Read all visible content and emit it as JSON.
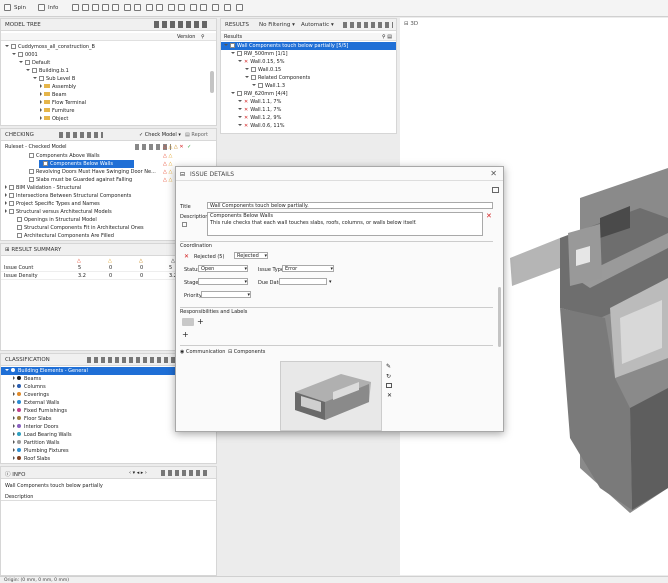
{
  "toolbar": {
    "spin": "Spin",
    "info": "Info"
  },
  "model_tree": {
    "title": "MODEL TREE",
    "version_col": "Version",
    "items": [
      {
        "label": "Cuddymoss_all_construction_B",
        "indent": 0
      },
      {
        "label": "0001",
        "indent": 1
      },
      {
        "label": "Default",
        "indent": 2
      },
      {
        "label": "Building.b.1",
        "indent": 3
      },
      {
        "label": "Sub Level B",
        "indent": 4
      },
      {
        "label": "Assembly",
        "indent": 5
      },
      {
        "label": "Beam",
        "indent": 5
      },
      {
        "label": "Flow Terminal",
        "indent": 5
      },
      {
        "label": "Furniture",
        "indent": 5
      },
      {
        "label": "Object",
        "indent": 5
      }
    ]
  },
  "checking": {
    "title": "CHECKING",
    "check_model": "Check Model",
    "report": "Report",
    "ruleset_label": "Ruleset - Checked Model",
    "items": [
      {
        "label": "Components Above Walls",
        "indent": 2,
        "selected": false
      },
      {
        "label": "Components Below Walls",
        "indent": 2,
        "selected": true
      },
      {
        "label": "Revolving Doors Must Have Swinging Door Ne...",
        "indent": 2,
        "selected": false
      },
      {
        "label": "Slabs must be Guarded against Falling",
        "indent": 2,
        "selected": false
      },
      {
        "label": "BIM Validation - Structural",
        "indent": 0,
        "selected": false
      },
      {
        "label": "Intersections Between Structural Components",
        "indent": 0,
        "selected": false
      },
      {
        "label": "Project Specific Types and Names",
        "indent": 0,
        "selected": false
      },
      {
        "label": "Structural versus Architectural Models",
        "indent": 0,
        "selected": false
      },
      {
        "label": "Openings in Structural Model",
        "indent": 1,
        "selected": false
      },
      {
        "label": "Structural Components Fit in Architectural Ones",
        "indent": 1,
        "selected": false
      },
      {
        "label": "Architectural Components Are Filled",
        "indent": 1,
        "selected": false
      }
    ]
  },
  "result_summary": {
    "title": "RESULT SUMMARY",
    "rows": [
      {
        "label": "Issue Count",
        "values": [
          "5",
          "0",
          "0",
          "5"
        ]
      },
      {
        "label": "Issue Density",
        "values": [
          "3.2",
          "0",
          "0",
          "3.2"
        ]
      }
    ]
  },
  "classification": {
    "title": "CLASSIFICATION",
    "root": "Building Elements - General",
    "items": [
      {
        "label": "Beams",
        "color": "#1a1a1a"
      },
      {
        "label": "Columns",
        "color": "#2a5db0"
      },
      {
        "label": "Coverings",
        "color": "#e08a2a"
      },
      {
        "label": "External Walls",
        "color": "#2a8ad0"
      },
      {
        "label": "Fixed Furnishings",
        "color": "#c0408a"
      },
      {
        "label": "Floor Slabs",
        "color": "#a08040"
      },
      {
        "label": "Interior Doors",
        "color": "#8a60c0"
      },
      {
        "label": "Load Bearing Walls",
        "color": "#30a0c0"
      },
      {
        "label": "Partition Walls",
        "color": "#9a9a9a"
      },
      {
        "label": "Plumbing Fixtures",
        "color": "#3090d0"
      },
      {
        "label": "Roof Slabs",
        "color": "#804020"
      }
    ]
  },
  "info": {
    "title": "INFO",
    "value": "Wall Components touch below partially",
    "description_label": "Description"
  },
  "results": {
    "title": "RESULTS",
    "filter": "No Filtering",
    "mode": "Automatic",
    "col": "Results",
    "items": [
      {
        "label": "Wall Components touch below partially [5/5]",
        "indent": 0,
        "selected": true,
        "x": false
      },
      {
        "label": "RW_500mm [1/1]",
        "indent": 1,
        "selected": false,
        "x": false
      },
      {
        "label": "Wall.0.15, 5%",
        "indent": 2,
        "selected": false,
        "x": true
      },
      {
        "label": "Wall.0.15",
        "indent": 3,
        "selected": false,
        "x": false
      },
      {
        "label": "Related Components",
        "indent": 3,
        "selected": false,
        "x": false
      },
      {
        "label": "Wall.1.3",
        "indent": 4,
        "selected": false,
        "x": false
      },
      {
        "label": "RW_620mm [4/4]",
        "indent": 1,
        "selected": false,
        "x": false
      },
      {
        "label": "Wall.1.1, 7%",
        "indent": 2,
        "selected": false,
        "x": true
      },
      {
        "label": "Wall.1.1, 7%",
        "indent": 2,
        "selected": false,
        "x": true
      },
      {
        "label": "Wall.1.2, 9%",
        "indent": 2,
        "selected": false,
        "x": true
      },
      {
        "label": "Wall.0.6, 11%",
        "indent": 2,
        "selected": false,
        "x": true
      }
    ]
  },
  "view3d": {
    "title": "3D"
  },
  "dialog": {
    "title": "ISSUE DETAILS",
    "title_label": "Title",
    "title_value": "Wall Components touch below partially.",
    "description_label": "Description",
    "description_line1": "Components Below Walls",
    "description_line2": "This rule checks that each wall touches slabs, roofs, columns, or walls below itself.",
    "coordination_label": "Coordination",
    "rejected_label": "Rejected (5)",
    "rejected_select": "Rejected",
    "status_label": "Status",
    "status_value": "Open",
    "issue_type_label": "Issue Type",
    "issue_type_value": "Error",
    "stage_label": "Stage",
    "due_date_label": "Due Date",
    "priority_label": "Priority",
    "responsibilities_label": "Responsibilities and Labels",
    "tab_communication": "Communication",
    "tab_components": "Components"
  },
  "statusbar": {
    "text": "Origin: (0 mm, 0 mm, 0 mm)"
  }
}
